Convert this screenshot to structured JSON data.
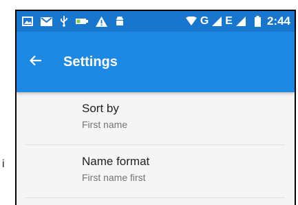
{
  "status_bar": {
    "left_icons": [
      "image-icon",
      "mail-icon",
      "usb-icon",
      "battery-saver-icon",
      "warning-icon",
      "android-icon"
    ],
    "network_label": "G",
    "network_label_2": "E",
    "time": "2:44"
  },
  "app_bar": {
    "title": "Settings",
    "back_icon": "arrow-back-icon"
  },
  "settings": [
    {
      "title": "Sort by",
      "value": "First name"
    },
    {
      "title": "Name format",
      "value": "First name first"
    }
  ],
  "colors": {
    "status_bar": "#1876cf",
    "app_bar": "#1e88e5",
    "background": "#f5f5f5"
  }
}
